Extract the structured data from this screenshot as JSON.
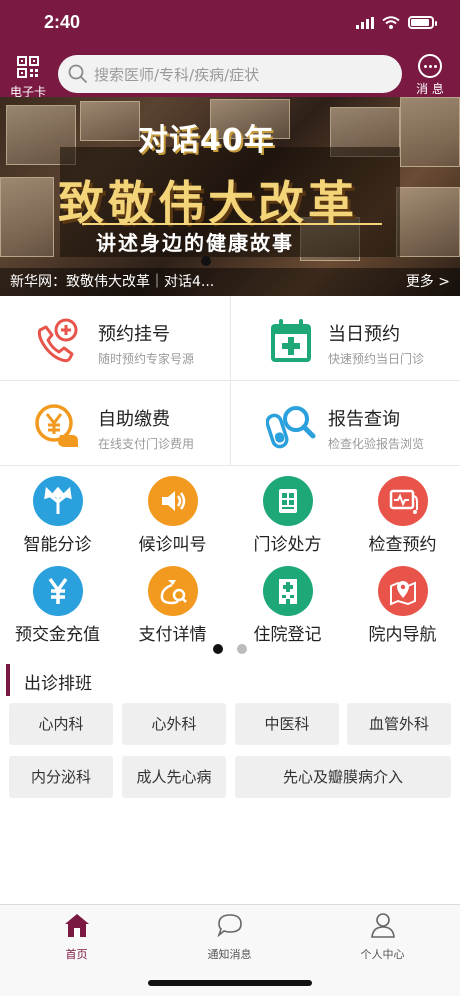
{
  "status_bar": {
    "time": "2:40"
  },
  "header": {
    "ecard_label": "电子卡",
    "search_placeholder": "搜索医师/专科/疾病/症状",
    "message_label": "消 息",
    "colors": {
      "header_bg": "#7a1942"
    }
  },
  "banner": {
    "title_line1": "对话40年",
    "title_line2": "致敬伟大改革",
    "title_line3": "讲述身边的健康故事",
    "caption": "新华网：致敬伟大改革｜对话4...",
    "more": "更多 >"
  },
  "services": [
    {
      "title": "预约挂号",
      "subtitle": "随时预约专家号源",
      "icon": "phone-plus-icon"
    },
    {
      "title": "当日预约",
      "subtitle": "快速预约当日门诊",
      "icon": "calendar-cross-icon"
    },
    {
      "title": "自助缴费",
      "subtitle": "在线支付门诊费用",
      "icon": "yen-hand-icon"
    },
    {
      "title": "报告查询",
      "subtitle": "检查化验报告浏览",
      "icon": "test-tube-magnifier-icon"
    }
  ],
  "quick_icons": [
    {
      "label": "智能分诊",
      "icon": "triage-arrows-icon",
      "color": "#2aa0dc"
    },
    {
      "label": "候诊叫号",
      "icon": "speaker-icon",
      "color": "#f29a20"
    },
    {
      "label": "门诊处方",
      "icon": "prescription-icon",
      "color": "#1ea878"
    },
    {
      "label": "检查预约",
      "icon": "monitor-heart-icon",
      "color": "#e8544a"
    },
    {
      "label": "预交金充值",
      "icon": "yen-icon",
      "color": "#2aa0dc"
    },
    {
      "label": "支付详情",
      "icon": "money-bag-search-icon",
      "color": "#f29a20"
    },
    {
      "label": "住院登记",
      "icon": "hospital-building-icon",
      "color": "#1ea878"
    },
    {
      "label": "院内导航",
      "icon": "map-pin-icon",
      "color": "#e8544a"
    }
  ],
  "schedule": {
    "title": "出诊排班",
    "departments": [
      "心内科",
      "心外科",
      "中医科",
      "血管外科",
      "内分泌科",
      "成人先心病",
      "先心及瓣膜病介入"
    ]
  },
  "tabbar": {
    "items": [
      {
        "label": "首页",
        "icon": "home-icon",
        "active": true
      },
      {
        "label": "通知消息",
        "icon": "chat-bubble-icon",
        "active": false
      },
      {
        "label": "个人中心",
        "icon": "person-icon",
        "active": false
      }
    ]
  }
}
